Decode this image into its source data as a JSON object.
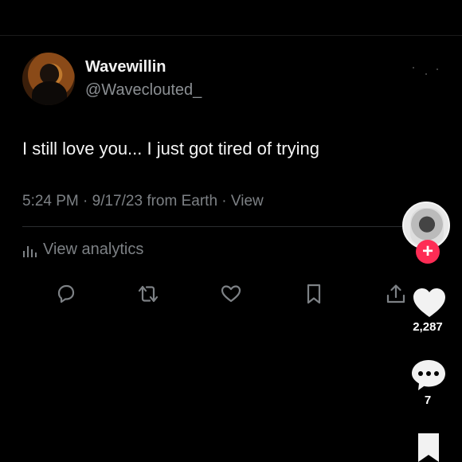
{
  "post": {
    "author_name": "Wavewillin",
    "author_handle": "@Waveclouted_",
    "text": "I still love you... I just got tired of trying",
    "meta": "5:24 PM · 9/17/23 from Earth · View",
    "analytics_label": "View analytics"
  },
  "actions": [
    {
      "name": "reply",
      "icon": "reply-icon"
    },
    {
      "name": "repost",
      "icon": "repost-icon"
    },
    {
      "name": "like",
      "icon": "heart-icon"
    },
    {
      "name": "bookmark",
      "icon": "bookmark-icon"
    },
    {
      "name": "share",
      "icon": "share-icon"
    }
  ],
  "side_rail": {
    "follow_icon": "plus-icon",
    "likes_count": "2,287",
    "comments_count": "7"
  },
  "colors": {
    "background": "#000000",
    "text": "#e7e9ea",
    "muted": "#7d8185",
    "follow_accent": "#fe2c55"
  }
}
